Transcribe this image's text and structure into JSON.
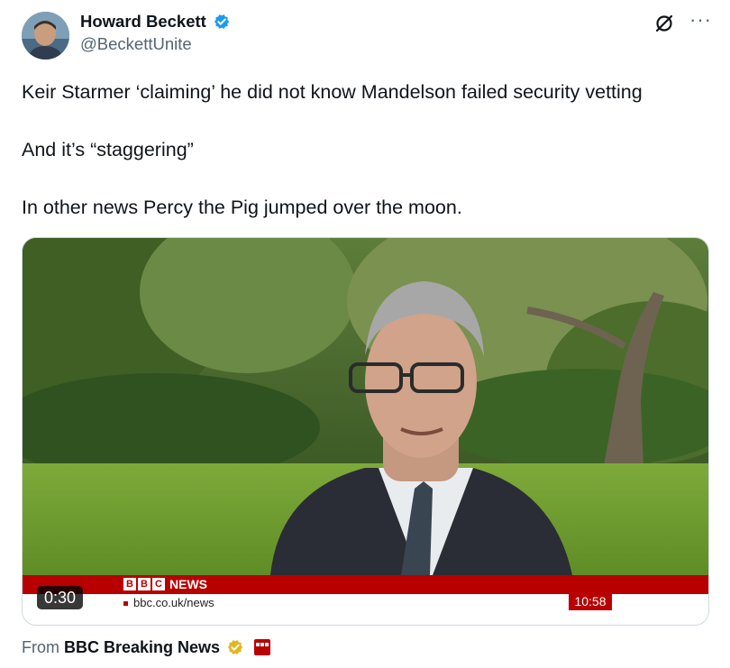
{
  "author": {
    "name": "Howard Beckett",
    "handle": "@BeckettUnite",
    "verified": true,
    "verified_color": "#1d9bf0"
  },
  "actions": {
    "grok_icon": "grok-icon",
    "more_label": "···"
  },
  "tweet": {
    "lines": [
      "Keir Starmer ‘claiming’ he did not know Mandelson failed security vetting",
      "And it’s “staggering”",
      "In other news Percy the Pig jumped over the moon."
    ]
  },
  "video": {
    "duration": "0:30",
    "bbc_letters": [
      "B",
      "B",
      "C"
    ],
    "news_label": "NEWS",
    "url": "bbc.co.uk/news",
    "clock": "10:58",
    "accent": "#b80000"
  },
  "attribution": {
    "prefix": "From",
    "source": "BBC Breaking News",
    "badge_color": "#e2b719"
  }
}
